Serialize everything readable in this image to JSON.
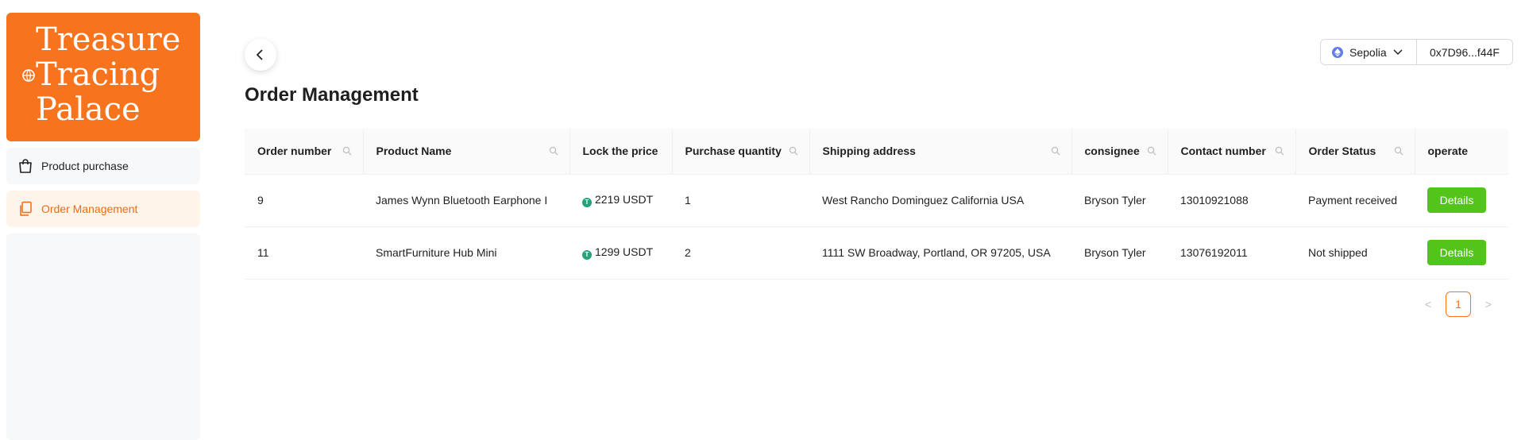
{
  "app": {
    "logo_lines": [
      "Treasure",
      "Tracing",
      "Palace"
    ]
  },
  "sidebar": {
    "items": [
      {
        "label": "Product purchase",
        "icon": "shopping-bag-icon",
        "active": false
      },
      {
        "label": "Order Management",
        "icon": "copy-documents-icon",
        "active": true
      }
    ]
  },
  "header": {
    "network": "Sepolia",
    "address": "0x7D96...f44F"
  },
  "page": {
    "title": "Order Management"
  },
  "table": {
    "columns": [
      "Order number",
      "Product Name",
      "Lock the price",
      "Purchase quantity",
      "Shipping address",
      "consignee",
      "Contact number",
      "Order Status",
      "operate"
    ],
    "rows": [
      {
        "order_number": "9",
        "product": "James Wynn Bluetooth Earphone I",
        "price": "2219 USDT",
        "qty": "1",
        "address": "West Rancho Dominguez California USA",
        "consignee": "Bryson Tyler",
        "contact": "13010921088",
        "status": "Payment received",
        "action": "Details"
      },
      {
        "order_number": "11",
        "product": "SmartFurniture Hub Mini",
        "price": "1299 USDT",
        "qty": "2",
        "address": "1111 SW Broadway, Portland, OR 97205, USA",
        "consignee": "Bryson Tyler",
        "contact": "13076192011",
        "status": "Not shipped",
        "action": "Details"
      }
    ]
  },
  "pagination": {
    "current": "1",
    "prev": "<",
    "next": ">"
  },
  "colors": {
    "brand": "#f7731d",
    "success": "#52c41a",
    "usdt": "#26a17b",
    "eth": "#627eea"
  }
}
